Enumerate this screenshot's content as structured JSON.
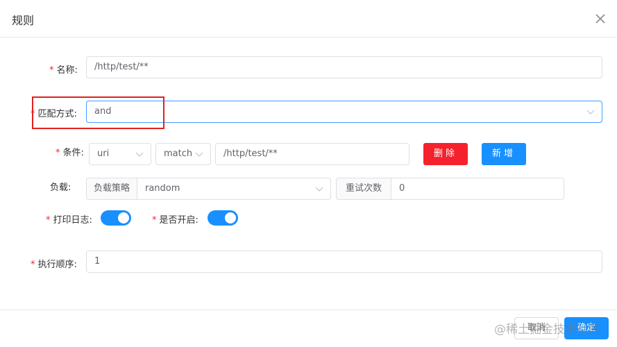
{
  "dialog": {
    "title": "规则"
  },
  "form": {
    "required_mark": "*",
    "name": {
      "label": "名称:",
      "value": "/http/test/**"
    },
    "match_mode": {
      "label": "匹配方式:",
      "value": "and"
    },
    "condition": {
      "label": "条件:",
      "type_value": "uri",
      "operator_value": "match",
      "pattern_value": "/http/test/**",
      "delete_label": "删除",
      "add_label": "新增"
    },
    "load": {
      "label": "负载:",
      "strategy_addon": "负载策略",
      "strategy_value": "random",
      "retry_addon": "重试次数",
      "retry_value": "0"
    },
    "print_log": {
      "label": "打印日志:",
      "on": true
    },
    "enabled": {
      "label": "是否开启:",
      "on": true
    },
    "order": {
      "label": "执行顺序:",
      "value": "1"
    }
  },
  "footer": {
    "cancel_label": "取消",
    "ok_label": "确定"
  },
  "watermark": "@稀土掘金技术社区",
  "colors": {
    "primary": "#1890ff",
    "danger": "#f5222d",
    "highlight": "#e02020"
  },
  "icons": {
    "close": "close-icon",
    "dropdown": "chevron-down-icon"
  }
}
